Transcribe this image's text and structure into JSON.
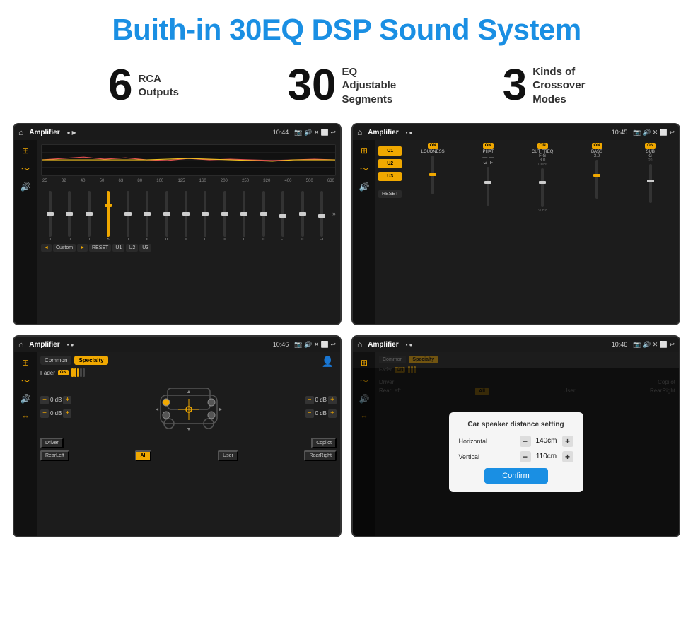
{
  "header": {
    "title": "Buith-in 30EQ DSP Sound System"
  },
  "stats": [
    {
      "number": "6",
      "label": "RCA\nOutputs"
    },
    {
      "number": "30",
      "label": "EQ Adjustable\nSegments"
    },
    {
      "number": "3",
      "label": "Kinds of\nCrossover Modes"
    }
  ],
  "screens": {
    "top_left": {
      "status": {
        "title": "Amplifier",
        "time": "10:44"
      },
      "eq": {
        "freqs": [
          "25",
          "32",
          "40",
          "50",
          "63",
          "80",
          "100",
          "125",
          "160",
          "200",
          "250",
          "320",
          "400",
          "500",
          "630"
        ],
        "values": [
          "0",
          "0",
          "0",
          "5",
          "0",
          "0",
          "0",
          "0",
          "0",
          "0",
          "0",
          "0",
          "-1",
          "0",
          "-1"
        ],
        "preset": "Custom",
        "buttons": [
          "◄",
          "Custom",
          "►",
          "RESET",
          "U1",
          "U2",
          "U3"
        ]
      }
    },
    "top_right": {
      "status": {
        "title": "Amplifier",
        "time": "10:45"
      },
      "u_buttons": [
        "U1",
        "U2",
        "U3"
      ],
      "controls": [
        "LOUDNESS",
        "PHAT",
        "CUT FREQ",
        "BASS",
        "SUB"
      ],
      "on_states": [
        true,
        true,
        true,
        true,
        true
      ],
      "reset_label": "RESET"
    },
    "bottom_left": {
      "status": {
        "title": "Amplifier",
        "time": "10:46"
      },
      "tabs": [
        "Common",
        "Specialty"
      ],
      "active_tab": "Specialty",
      "fader_label": "Fader",
      "on_label": "ON",
      "db_values": [
        "0 dB",
        "0 dB",
        "0 dB",
        "0 dB"
      ],
      "buttons": [
        "Driver",
        "RearLeft",
        "All",
        "User",
        "Copilot",
        "RearRight"
      ]
    },
    "bottom_right": {
      "status": {
        "title": "Amplifier",
        "time": "10:46"
      },
      "tabs": [
        "Common",
        "Specialty"
      ],
      "dialog": {
        "title": "Car speaker distance setting",
        "horizontal_label": "Horizontal",
        "horizontal_value": "140cm",
        "vertical_label": "Vertical",
        "vertical_value": "110cm",
        "confirm_label": "Confirm"
      },
      "buttons": [
        "Driver",
        "RearLeft",
        "All",
        "User",
        "Copilot",
        "RearRight"
      ]
    }
  }
}
